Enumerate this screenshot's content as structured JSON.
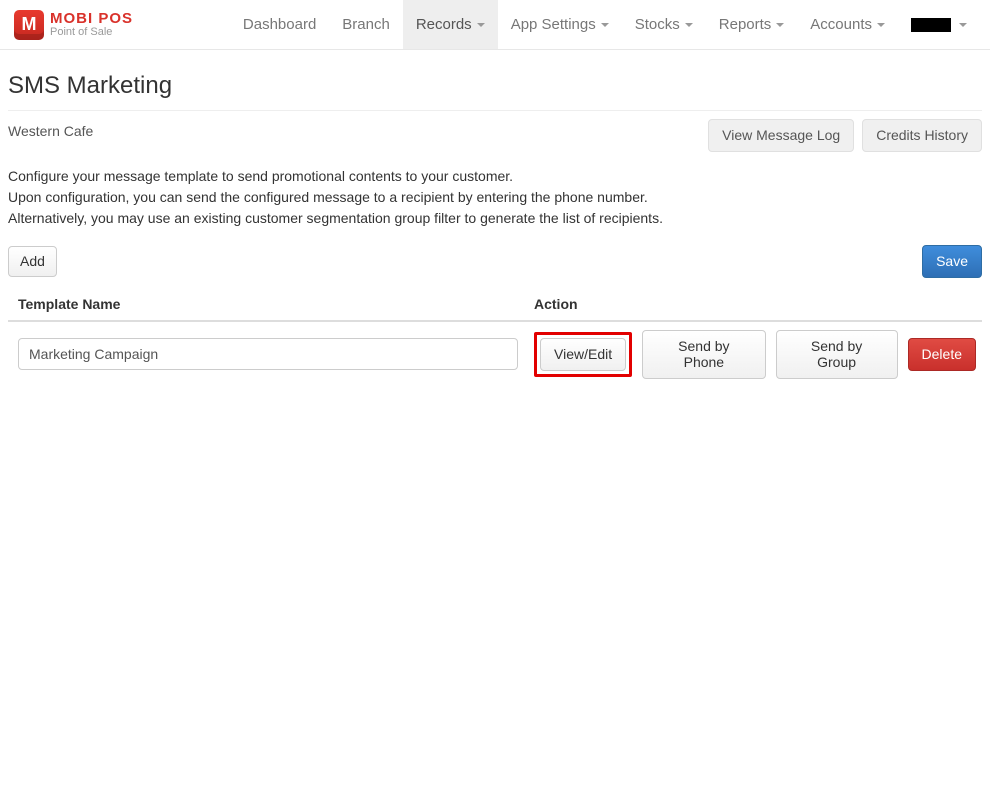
{
  "brand": {
    "title": "MOBI POS",
    "subtitle": "Point of Sale",
    "iconLetter": "M"
  },
  "nav": {
    "items": [
      {
        "label": "Dashboard",
        "hasCaret": false,
        "active": false
      },
      {
        "label": "Branch",
        "hasCaret": false,
        "active": false
      },
      {
        "label": "Records",
        "hasCaret": true,
        "active": true
      },
      {
        "label": "App Settings",
        "hasCaret": true,
        "active": false
      },
      {
        "label": "Stocks",
        "hasCaret": true,
        "active": false
      },
      {
        "label": "Reports",
        "hasCaret": true,
        "active": false
      },
      {
        "label": "Accounts",
        "hasCaret": true,
        "active": false
      }
    ]
  },
  "page": {
    "title": "SMS Marketing",
    "subtitle": "Western Cafe",
    "descriptionLines": [
      "Configure your message template to send promotional contents to your customer.",
      "Upon configuration, you can send the configured message to a recipient by entering the phone number.",
      "Alternatively, you may use an existing customer segmentation group filter to generate the list of recipients."
    ],
    "buttons": {
      "viewLog": "View Message Log",
      "creditsHistory": "Credits History",
      "add": "Add",
      "save": "Save"
    },
    "table": {
      "headers": {
        "templateName": "Template Name",
        "action": "Action"
      },
      "rows": [
        {
          "name": "Marketing Campaign",
          "actions": {
            "viewEdit": "View/Edit",
            "sendByPhone": "Send by Phone",
            "sendByGroup": "Send by Group",
            "delete": "Delete"
          }
        }
      ]
    }
  }
}
